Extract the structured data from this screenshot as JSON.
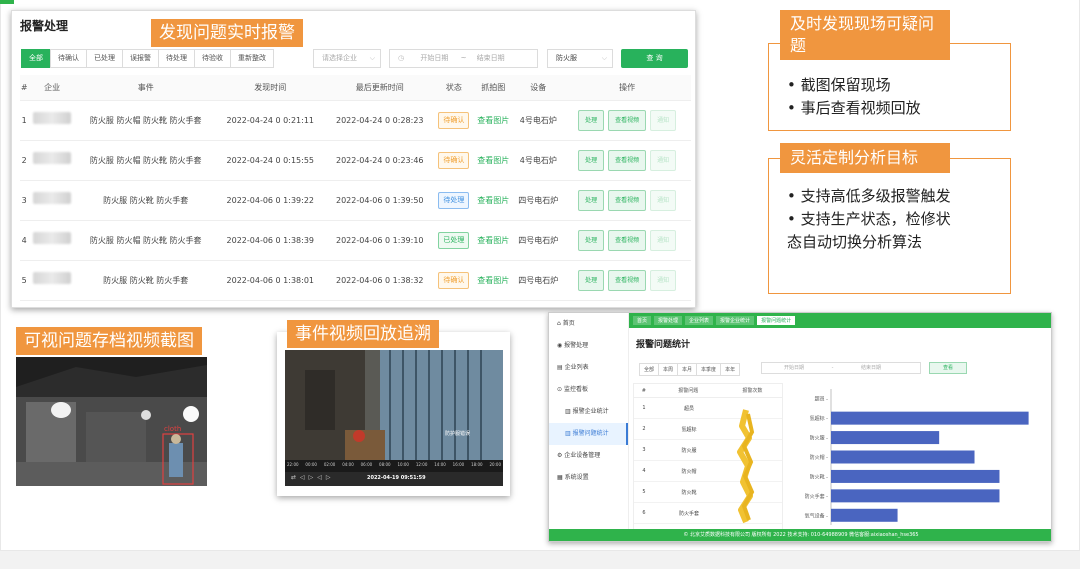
{
  "panel": {
    "title": "报警处理",
    "overlay_label": "发现问题实时报警",
    "filter_tabs": [
      "全部",
      "待确认",
      "已处理",
      "误报警",
      "待处理",
      "待验收",
      "重新整改"
    ],
    "enterprise_placeholder": "请选择企业",
    "date_start_placeholder": "开始日期",
    "date_sep": "~",
    "date_end_placeholder": "结束日期",
    "type_select": "防火服",
    "query_label": "查 询",
    "columns": [
      "#",
      "企业",
      "事件",
      "发现时间",
      "最后更新时间",
      "状态",
      "抓拍图",
      "设备",
      "操作"
    ],
    "rows": [
      {
        "idx": "1",
        "event": "防火服 防火帽 防火靴 防火手套",
        "found": "2022-04-24 0 0:21:11",
        "updated": "2022-04-24 0 0:28:23",
        "status": "待确认",
        "status_kind": "o",
        "snapshot": "查看图片",
        "device": "4号电石炉"
      },
      {
        "idx": "2",
        "event": "防火服 防火帽 防火靴 防火手套",
        "found": "2022-04-24 0 0:15:55",
        "updated": "2022-04-24 0 0:23:46",
        "status": "待确认",
        "status_kind": "o",
        "snapshot": "查看图片",
        "device": "4号电石炉"
      },
      {
        "idx": "3",
        "event": "防火服 防火靴 防火手套",
        "found": "2022-04-06 0 1:39:22",
        "updated": "2022-04-06 0 1:39:50",
        "status": "待处理",
        "status_kind": "b",
        "snapshot": "查看图片",
        "device": "四号电石炉"
      },
      {
        "idx": "4",
        "event": "防火服 防火帽 防火靴 防火手套",
        "found": "2022-04-06 0 1:38:39",
        "updated": "2022-04-06 0 1:39:10",
        "status": "已处理",
        "status_kind": "g",
        "snapshot": "查看图片",
        "device": "四号电石炉"
      },
      {
        "idx": "5",
        "event": "防火服 防火靴 防火手套",
        "found": "2022-04-06 0 1:38:01",
        "updated": "2022-04-06 0 1:38:32",
        "status": "待确认",
        "status_kind": "o",
        "snapshot": "查看图片",
        "device": "四号电石炉"
      }
    ],
    "op_labels": [
      "处理",
      "查看视频",
      "通知"
    ]
  },
  "box1": {
    "title": "及时发现现场可疑问题",
    "bullets": [
      "截图保留现场",
      "事后查看视频回放"
    ]
  },
  "box2": {
    "title": "灵活定制分析目标",
    "bullets": [
      "支持高低多级报警触发",
      "支持生产状态，检修状",
      "态自动切换分析算法"
    ]
  },
  "shot1": {
    "label": "可视问题存档视频截图",
    "detect_tag": "cloth"
  },
  "shot2": {
    "label": "事件视频回放追溯",
    "detect_tag": "防护服错误",
    "timeline": [
      "22:00",
      "00:00",
      "02:00",
      "04:00",
      "06:00",
      "08:00",
      "10:00",
      "12:00",
      "14:00",
      "16:00",
      "18:00",
      "20:00"
    ],
    "player_time": "2022-04-19 09:51:59"
  },
  "dashboard": {
    "tabs": [
      "首页",
      "报警处理",
      "企业列表",
      "报警企业统计",
      "报警问题统计"
    ],
    "sidebar": [
      "首页",
      "报警处理",
      "企业列表",
      "监控看板",
      "报警企业统计",
      "报警问题统计",
      "企业设备管理",
      "系统设置"
    ],
    "title": "报警问题统计",
    "range_tabs": [
      "全部",
      "本周",
      "本月",
      "本季度",
      "本年"
    ],
    "date_start": "开始日期",
    "date_end": "结束日期",
    "query": "查看",
    "columns": [
      "#",
      "报警问题",
      "报警次数"
    ],
    "footer": "© 北京艾质数据科技有限公司  版权所有  2022 技术支持: 010-64988909  微信客服:aixiaoshan_hse365"
  },
  "chart_data": {
    "type": "bar",
    "orientation": "horizontal",
    "categories": [
      "超员",
      "氢超标",
      "防火服",
      "防火帽",
      "防火靴",
      "防火手套",
      "氧气设备"
    ],
    "values": [
      0,
      95,
      52,
      69,
      81,
      81,
      32
    ],
    "title": "",
    "xlabel": "",
    "ylabel": "",
    "xlim": [
      0,
      100
    ],
    "color": "#4a65c0"
  }
}
